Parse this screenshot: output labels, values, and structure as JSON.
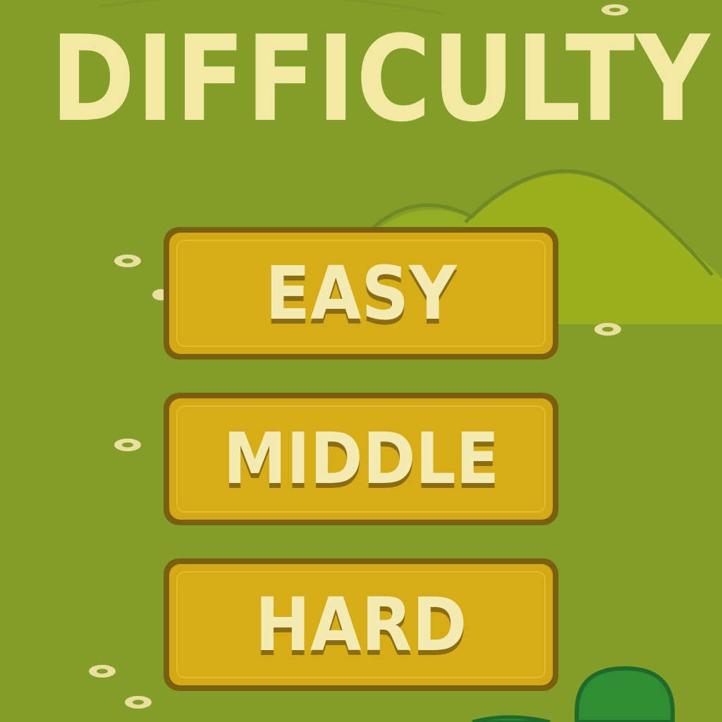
{
  "screen": {
    "title": "DIFFICULTY"
  },
  "buttons": {
    "easy_label": "EASY",
    "middle_label": "MIDDLE",
    "hard_label": "HARD"
  },
  "colors": {
    "background": "#839d29",
    "title_text": "#f2e9a4",
    "button_fill": "#d6ac17",
    "button_border": "#7a5f10",
    "button_text": "#f3ebb1",
    "hill": "#99b21e",
    "bush": "#2f8e34"
  }
}
